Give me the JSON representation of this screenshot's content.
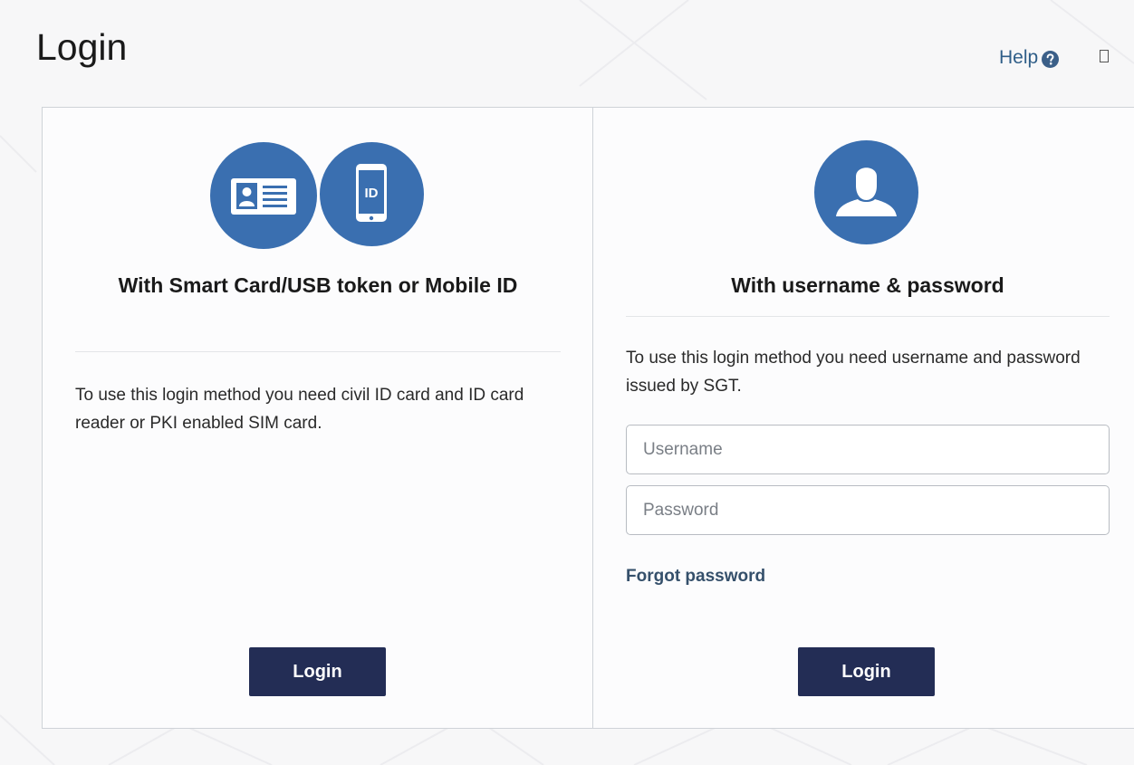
{
  "page": {
    "title": "Login",
    "help_label": "Help"
  },
  "smartcard": {
    "heading": "With Smart Card/USB token or Mobile ID",
    "description": "To use this login method you need civil ID card and ID card reader or PKI enabled SIM card.",
    "login_label": "Login",
    "icons": [
      "id-card-icon",
      "mobile-id-icon"
    ],
    "mobile_icon_text": "ID"
  },
  "credentials": {
    "heading": "With username & password",
    "description": "To use this login method you need username and password issued by SGT.",
    "username_placeholder": "Username",
    "username_value": "",
    "password_placeholder": "Password",
    "password_value": "",
    "forgot_label": "Forgot password",
    "login_label": "Login",
    "icons": [
      "user-icon"
    ]
  },
  "theme": {
    "accent": "#3a6fb0",
    "button": "#232d55",
    "link": "#35506b",
    "help_link": "#2f5e88"
  }
}
